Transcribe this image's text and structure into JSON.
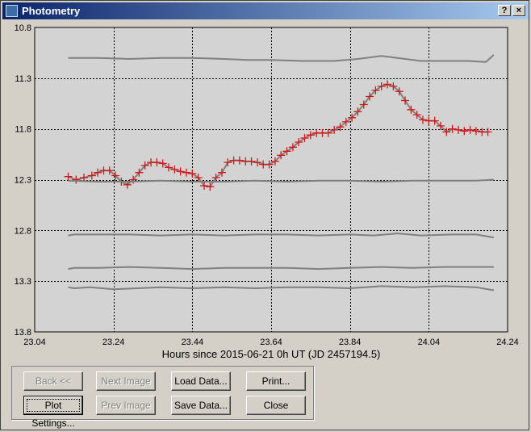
{
  "window": {
    "title": "Photometry",
    "help_label": "?",
    "close_label": "×"
  },
  "buttons": {
    "back": "Back <<",
    "next_image": "Next Image",
    "load_data": "Load Data...",
    "print": "Print...",
    "plot_settings": "Plot Settings...",
    "prev_image": "Prev Image",
    "save_data": "Save Data...",
    "close": "Close"
  },
  "colors": {
    "plot_bg": "#d3d3d3",
    "target": "#d01818",
    "comparison": "#808080"
  },
  "chart_data": {
    "type": "line",
    "xlabel": "Hours since 2015-06-21 0h UT (JD 2457194.5)",
    "ylabel": "",
    "xlim": [
      23.04,
      24.24
    ],
    "ylim": [
      13.8,
      10.8
    ],
    "y_inverted": true,
    "x_ticks": [
      23.04,
      23.24,
      23.44,
      23.64,
      23.84,
      24.04,
      24.24
    ],
    "x_tick_labels": [
      "23.04",
      "23.24",
      "23.44",
      "23.64",
      "23.84",
      "24.04",
      "24.24"
    ],
    "y_ticks": [
      10.8,
      11.3,
      11.8,
      12.3,
      12.8,
      13.3,
      13.8
    ],
    "y_tick_labels": [
      "10.8",
      "11.3",
      "11.8",
      "12.3",
      "12.8",
      "13.3",
      "13.8"
    ],
    "grid": true,
    "series": [
      {
        "role": "target",
        "marker": "+",
        "x": [
          23.125,
          23.145,
          23.165,
          23.185,
          23.2,
          23.215,
          23.23,
          23.245,
          23.26,
          23.275,
          23.29,
          23.305,
          23.32,
          23.335,
          23.35,
          23.365,
          23.38,
          23.395,
          23.41,
          23.425,
          23.44,
          23.455,
          23.47,
          23.485,
          23.5,
          23.515,
          23.53,
          23.545,
          23.56,
          23.575,
          23.59,
          23.605,
          23.62,
          23.635,
          23.65,
          23.665,
          23.68,
          23.695,
          23.71,
          23.725,
          23.74,
          23.755,
          23.77,
          23.785,
          23.8,
          23.815,
          23.83,
          23.845,
          23.86,
          23.875,
          23.89,
          23.905,
          23.92,
          23.935,
          23.95,
          23.965,
          23.98,
          23.995,
          24.01,
          24.025,
          24.04,
          24.055,
          24.07,
          24.085,
          24.1,
          24.115,
          24.13,
          24.145,
          24.16,
          24.175,
          24.19
        ],
        "y": [
          12.27,
          12.3,
          12.28,
          12.26,
          12.23,
          12.21,
          12.21,
          12.26,
          12.32,
          12.35,
          12.3,
          12.23,
          12.16,
          12.13,
          12.13,
          12.14,
          12.18,
          12.2,
          12.22,
          12.23,
          12.24,
          12.28,
          12.36,
          12.37,
          12.28,
          12.23,
          12.13,
          12.11,
          12.11,
          12.12,
          12.12,
          12.13,
          12.15,
          12.15,
          12.12,
          12.06,
          12.02,
          11.98,
          11.93,
          11.89,
          11.86,
          11.84,
          11.84,
          11.84,
          11.81,
          11.78,
          11.73,
          11.69,
          11.63,
          11.56,
          11.48,
          11.42,
          11.38,
          11.36,
          11.38,
          11.43,
          11.52,
          11.61,
          11.66,
          11.71,
          11.72,
          11.72,
          11.77,
          11.83,
          11.8,
          11.81,
          11.82,
          11.81,
          11.82,
          11.83,
          11.83
        ]
      },
      {
        "role": "comparison",
        "x": [
          23.125,
          23.2,
          23.28,
          23.36,
          23.44,
          23.52,
          23.58,
          23.64,
          23.72,
          23.8,
          23.86,
          23.92,
          23.96,
          24.02,
          24.08,
          24.14,
          24.185,
          24.205
        ],
        "y": [
          11.1,
          11.1,
          11.11,
          11.1,
          11.1,
          11.11,
          11.12,
          11.12,
          11.13,
          11.13,
          11.11,
          11.08,
          11.1,
          11.13,
          11.13,
          11.13,
          11.14,
          11.07
        ]
      },
      {
        "role": "comparison",
        "x": [
          23.125,
          23.2,
          23.28,
          23.36,
          23.44,
          23.52,
          23.6,
          23.68,
          23.76,
          23.84,
          23.92,
          24.0,
          24.08,
          24.16,
          24.205
        ],
        "y": [
          12.31,
          12.32,
          12.32,
          12.31,
          12.32,
          12.32,
          12.31,
          12.32,
          12.31,
          12.31,
          12.32,
          12.31,
          12.31,
          12.31,
          12.3
        ]
      },
      {
        "role": "comparison",
        "x": [
          23.125,
          23.14,
          23.2,
          23.28,
          23.36,
          23.44,
          23.52,
          23.6,
          23.68,
          23.76,
          23.84,
          23.9,
          23.96,
          24.02,
          24.1,
          24.16,
          24.205
        ],
        "y": [
          12.85,
          12.84,
          12.84,
          12.84,
          12.85,
          12.84,
          12.85,
          12.84,
          12.84,
          12.85,
          12.84,
          12.85,
          12.83,
          12.85,
          12.84,
          12.84,
          12.87
        ]
      },
      {
        "role": "comparison",
        "x": [
          23.125,
          23.14,
          23.2,
          23.28,
          23.36,
          23.44,
          23.52,
          23.6,
          23.68,
          23.76,
          23.84,
          23.92,
          24.0,
          24.08,
          24.16,
          24.205
        ],
        "y": [
          13.18,
          13.17,
          13.17,
          13.16,
          13.17,
          13.18,
          13.17,
          13.17,
          13.17,
          13.18,
          13.17,
          13.16,
          13.17,
          13.16,
          13.16,
          13.16
        ]
      },
      {
        "role": "comparison",
        "x": [
          23.125,
          23.14,
          23.18,
          23.24,
          23.3,
          23.36,
          23.44,
          23.52,
          23.6,
          23.68,
          23.76,
          23.84,
          23.92,
          24.0,
          24.08,
          24.16,
          24.205
        ],
        "y": [
          13.36,
          13.37,
          13.36,
          13.38,
          13.37,
          13.36,
          13.37,
          13.36,
          13.37,
          13.36,
          13.36,
          13.37,
          13.35,
          13.36,
          13.35,
          13.36,
          13.39
        ]
      }
    ]
  }
}
